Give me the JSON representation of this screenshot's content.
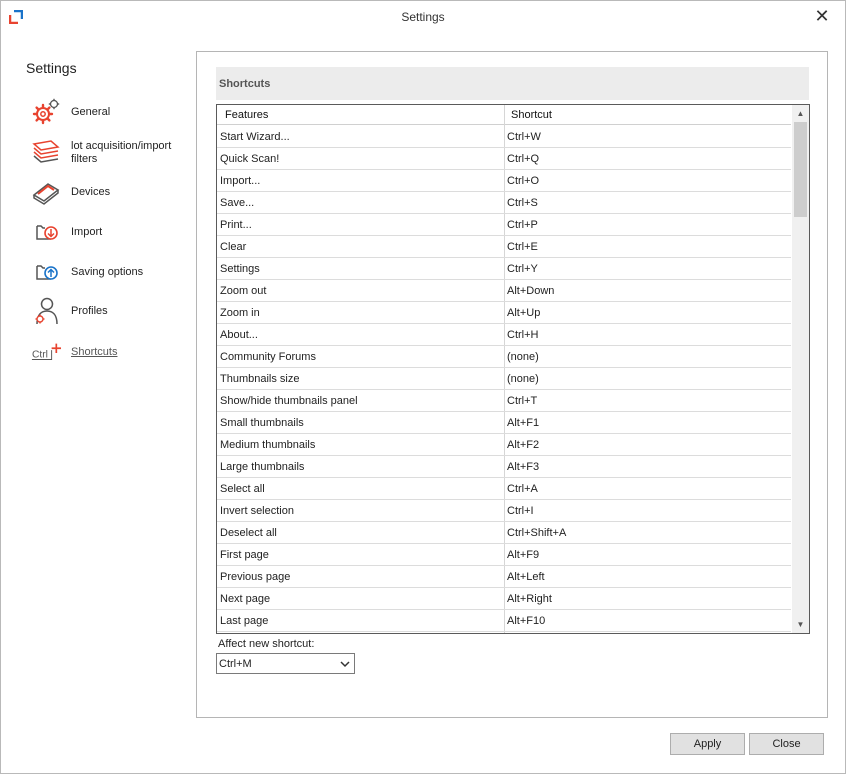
{
  "window": {
    "title": "Settings",
    "close_glyph": "✕"
  },
  "sidebar": {
    "title": "Settings",
    "items": [
      {
        "label": "General",
        "icon": "gears-icon"
      },
      {
        "label": "lot acquisition/import filters",
        "icon": "stacked-pages-icon"
      },
      {
        "label": "Devices",
        "icon": "scanner-icon"
      },
      {
        "label": "Import",
        "icon": "folder-import-icon"
      },
      {
        "label": "Saving options",
        "icon": "folder-save-icon"
      },
      {
        "label": "Profiles",
        "icon": "user-profile-icon"
      },
      {
        "label": "Shortcuts",
        "icon": "ctrl-plus-icon",
        "active": true
      }
    ]
  },
  "shortcuts": {
    "section_title": "Shortcuts",
    "columns": [
      "Features",
      "Shortcut"
    ],
    "rows": [
      [
        "Start Wizard...",
        "Ctrl+W"
      ],
      [
        "Quick Scan!",
        "Ctrl+Q"
      ],
      [
        "Import...",
        "Ctrl+O"
      ],
      [
        "Save...",
        "Ctrl+S"
      ],
      [
        "Print...",
        "Ctrl+P"
      ],
      [
        "Clear",
        "Ctrl+E"
      ],
      [
        "Settings",
        "Ctrl+Y"
      ],
      [
        "Zoom out",
        "Alt+Down"
      ],
      [
        "Zoom in",
        "Alt+Up"
      ],
      [
        "About...",
        "Ctrl+H"
      ],
      [
        "Community Forums",
        "(none)"
      ],
      [
        "Thumbnails size",
        "(none)"
      ],
      [
        "Show/hide thumbnails panel",
        "Ctrl+T"
      ],
      [
        "Small thumbnails",
        "Alt+F1"
      ],
      [
        "Medium thumbnails",
        "Alt+F2"
      ],
      [
        "Large thumbnails",
        "Alt+F3"
      ],
      [
        "Select all",
        "Ctrl+A"
      ],
      [
        "Invert selection",
        "Ctrl+I"
      ],
      [
        "Deselect all",
        "Ctrl+Shift+A"
      ],
      [
        "First page",
        "Alt+F9"
      ],
      [
        "Previous page",
        "Alt+Left"
      ],
      [
        "Next page",
        "Alt+Right"
      ],
      [
        "Last page",
        "Alt+F10"
      ]
    ],
    "affect_label": "Affect new shortcut:",
    "affect_value": "Ctrl+M"
  },
  "buttons": {
    "apply": "Apply",
    "close": "Close"
  },
  "colors": {
    "accent_red": "#e8432f",
    "accent_blue": "#1a73c9"
  }
}
